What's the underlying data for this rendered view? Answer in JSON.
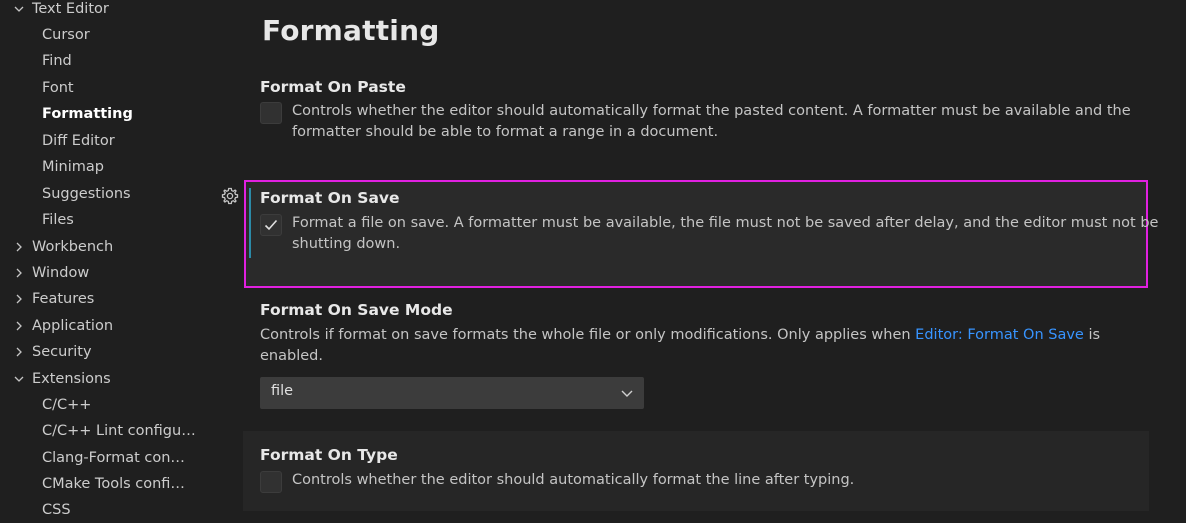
{
  "sidebar": {
    "items": [
      {
        "label": "Text Editor",
        "level": "top",
        "expanded": true
      },
      {
        "label": "Cursor",
        "level": "child"
      },
      {
        "label": "Find",
        "level": "child"
      },
      {
        "label": "Font",
        "level": "child"
      },
      {
        "label": "Formatting",
        "level": "child",
        "active": true
      },
      {
        "label": "Diff Editor",
        "level": "child"
      },
      {
        "label": "Minimap",
        "level": "child"
      },
      {
        "label": "Suggestions",
        "level": "child"
      },
      {
        "label": "Files",
        "level": "child"
      },
      {
        "label": "Workbench",
        "level": "top",
        "expanded": false
      },
      {
        "label": "Window",
        "level": "top",
        "expanded": false
      },
      {
        "label": "Features",
        "level": "top",
        "expanded": false
      },
      {
        "label": "Application",
        "level": "top",
        "expanded": false
      },
      {
        "label": "Security",
        "level": "top",
        "expanded": false
      },
      {
        "label": "Extensions",
        "level": "top",
        "expanded": true
      },
      {
        "label": "C/C++",
        "level": "child"
      },
      {
        "label": "C/C++ Lint configu…",
        "level": "child"
      },
      {
        "label": "Clang-Format con…",
        "level": "child"
      },
      {
        "label": "CMake Tools confi…",
        "level": "child"
      },
      {
        "label": "CSS",
        "level": "child"
      }
    ]
  },
  "main": {
    "section_title": "Formatting",
    "settings": {
      "format_on_paste": {
        "title": "Format On Paste",
        "description_line1": "Controls whether the editor should automatically format the pasted content. A formatter must be available and the",
        "description_line2": "formatter should be able to format a range in a document.",
        "checked": false
      },
      "format_on_save": {
        "title": "Format On Save",
        "description_line1": "Format a file on save. A formatter must be available, the file must not be saved after delay, and the editor must not be",
        "description_line2": "shutting down.",
        "checked": true
      },
      "format_on_save_mode": {
        "title": "Format On Save Mode",
        "description_prefix": "Controls if format on save formats the whole file or only modifications. Only applies when ",
        "description_link": "Editor: Format On Save",
        "description_suffix": " is",
        "description_line2": "enabled.",
        "selected_value": "file"
      },
      "format_on_type": {
        "title": "Format On Type",
        "description_line1": "Controls whether the editor should automatically format the line after typing.",
        "checked": false
      }
    }
  },
  "icons": {
    "chevron_down": "chevron-down-icon",
    "chevron_right": "chevron-right-icon",
    "gear": "gear-icon",
    "check": "check-icon"
  },
  "colors": {
    "focus_outline": "#e020e0",
    "link": "#3794ff",
    "modified_indicator": "#2b8aa8"
  }
}
